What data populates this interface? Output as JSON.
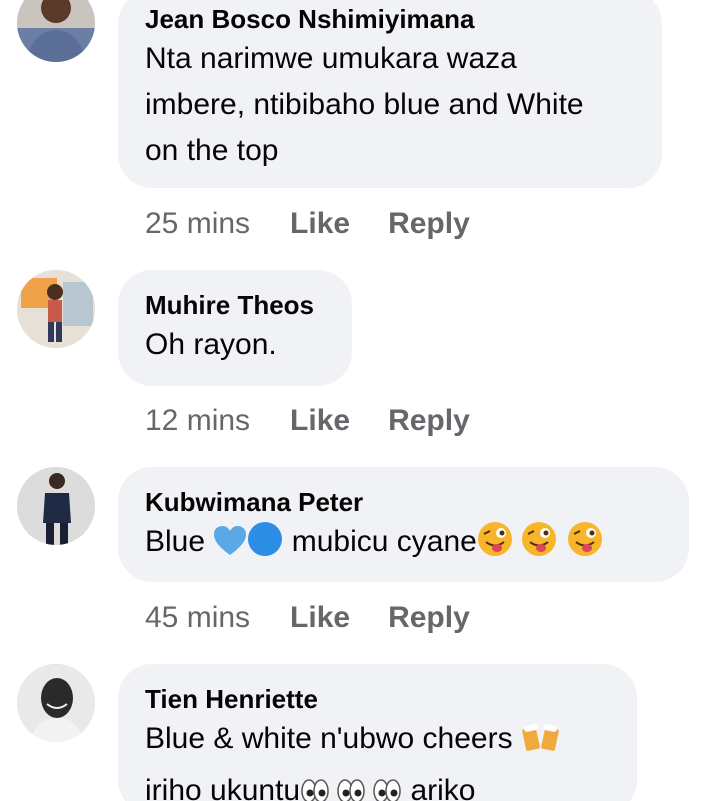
{
  "comments": [
    {
      "author": "Jean Bosco Nshimiyimana",
      "lines": [
        "Nta narimwe umukara waza",
        "imbere, ntibibaho blue and White",
        "on the top"
      ],
      "time": "25 mins",
      "like": "Like",
      "reply": "Reply"
    },
    {
      "author": "Muhire Theos",
      "lines": [
        "Oh rayon."
      ],
      "time": "12 mins",
      "like": "Like",
      "reply": "Reply"
    },
    {
      "author": "Kubwimana Peter",
      "text_before": "Blue ",
      "text_after": " mubicu cyane",
      "emojis": [
        "blue-heart-icon",
        "blue-circle-icon",
        "winking-tongue-face-icon"
      ],
      "time": "45 mins",
      "like": "Like",
      "reply": "Reply"
    },
    {
      "author": "Tien Henriette",
      "line1": "Blue & white n'ubwo cheers ",
      "line2_before": "iriho ukuntu",
      "line2_after": " ariko",
      "emojis": [
        "beer-mugs-icon",
        "eyes-icon"
      ]
    }
  ],
  "colors": {
    "bubble": "#f0f2f5",
    "meta_text": "#65676b",
    "body_text": "#050505",
    "blue_heart": "#5aa9e6",
    "blue_circle": "#2d8ee6",
    "emoji_face": "#f7b52b"
  }
}
